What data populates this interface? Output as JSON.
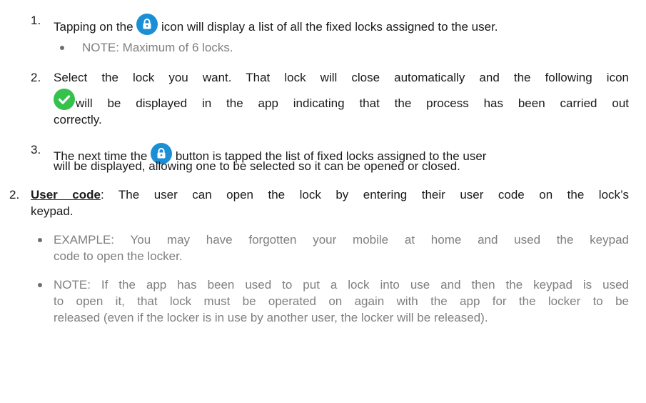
{
  "steps": {
    "step1": {
      "num": "1.",
      "before": "Tapping on the",
      "icon": "lock-icon",
      "after": "icon will display a list of all the fixed locks assigned to the user."
    },
    "note1": "NOTE: Maximum of 6 locks.",
    "step2": {
      "num": "2.",
      "line1": "Select the lock you want. That lock will close automatically and the following icon",
      "icon": "check-icon",
      "line2": "will be displayed in the app indicating that the process has been carried out",
      "line3": "correctly."
    },
    "step3": {
      "num": "3.",
      "before": "The next time the",
      "icon": "lock-icon",
      "after": "button is tapped the list of fixed locks assigned to the user",
      "line2": "will be displayed, allowing one to be selected so it can be opened or closed."
    }
  },
  "section2": {
    "num": "2.",
    "title": "User code",
    "line1": ": The user can open the lock by entering their user code on the lock’s",
    "line2": "keypad.",
    "example_line1": "EXAMPLE: You may have forgotten your mobile at home and used the keypad",
    "example_line2": "code to open the locker.",
    "note_line1": "NOTE: If the app has been used to put a lock into use and then the keypad is used",
    "note_line2": "to open it, that lock must be operated on again with the app for the locker to be",
    "note_line3": "released (even if the locker is in use by another user, the locker will be released)."
  },
  "colors": {
    "lock_icon": "#1a8fd6",
    "check_icon": "#35c14c",
    "note_text": "#7f7f7f"
  }
}
